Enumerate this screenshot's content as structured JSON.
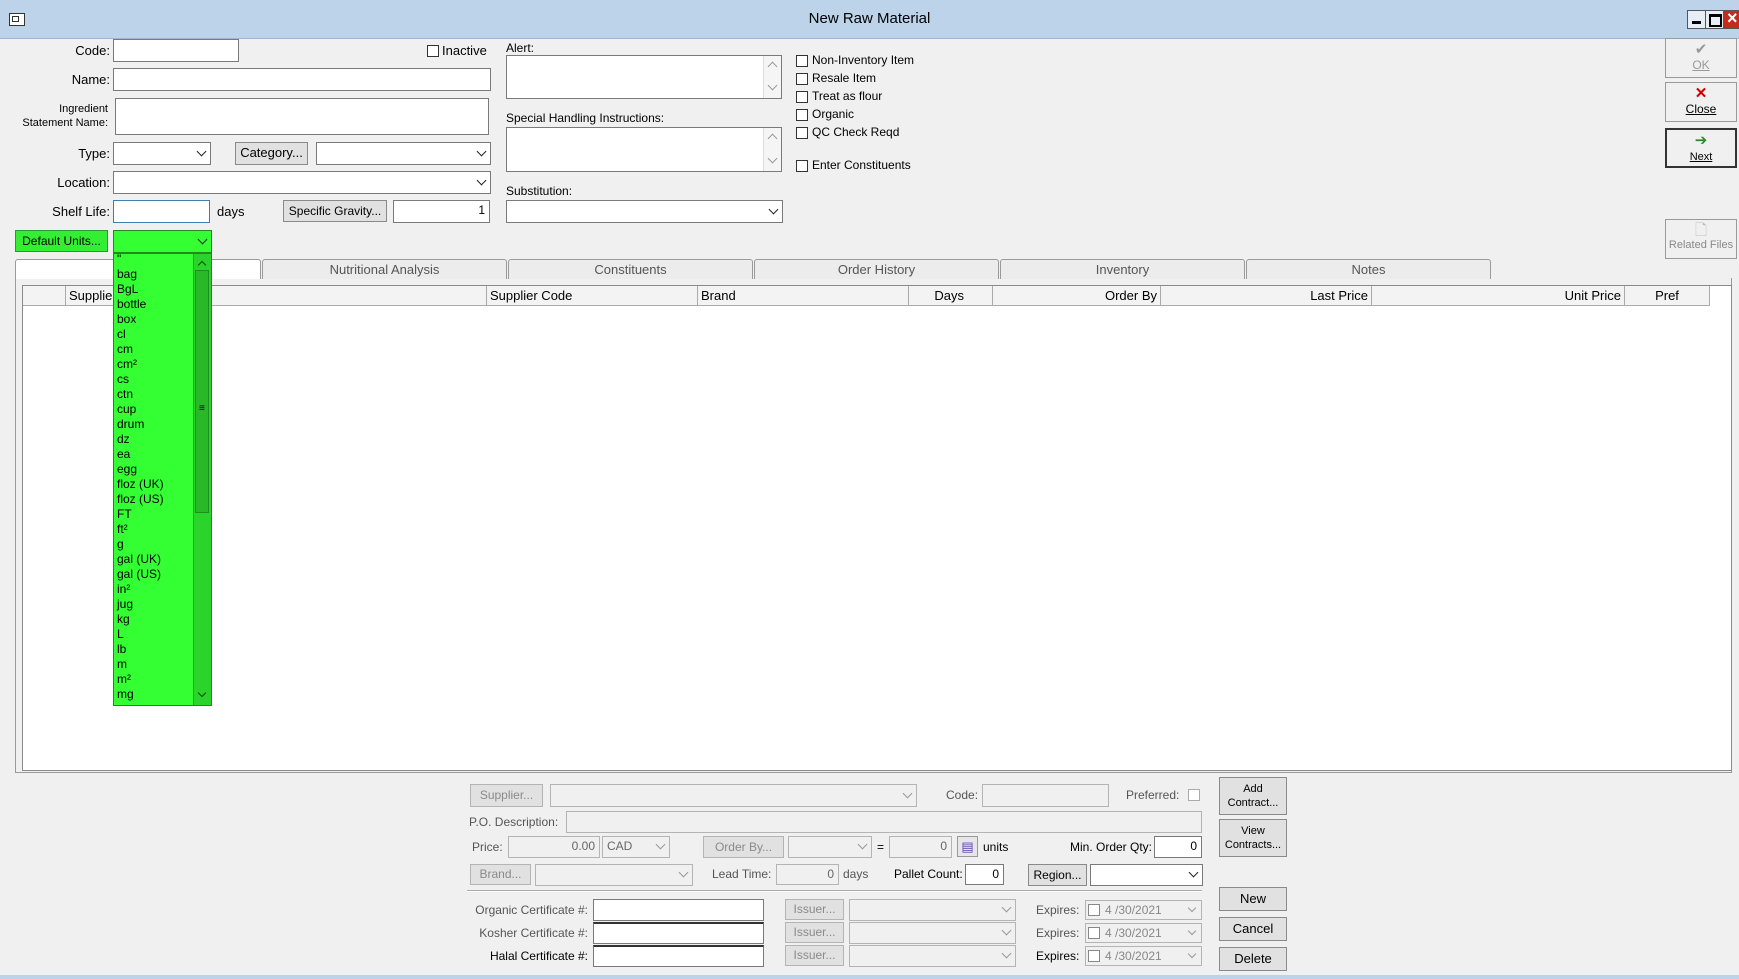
{
  "window": {
    "title": "New Raw Material"
  },
  "form": {
    "code_label": "Code:",
    "inactive_label": "Inactive",
    "name_label": "Name:",
    "ingredient_statement_label_line1": "Ingredient",
    "ingredient_statement_label_line2": "Statement Name:",
    "type_label": "Type:",
    "category_button": "Category...",
    "location_label": "Location:",
    "shelf_life_label": "Shelf Life:",
    "shelf_life_unit": "days",
    "specific_gravity_button": "Specific Gravity...",
    "specific_gravity_value": "1",
    "default_units_button": "Default Units...",
    "alert_label": "Alert:",
    "special_handling_label": "Special Handling Instructions:",
    "substitution_label": "Substitution:"
  },
  "checkboxes": [
    {
      "label": "Non-Inventory Item"
    },
    {
      "label": "Resale Item"
    },
    {
      "label": "Treat as flour"
    },
    {
      "label": "Organic"
    },
    {
      "label": "QC Check Reqd"
    },
    {
      "label": "Enter Constituents"
    }
  ],
  "side_buttons": {
    "ok": {
      "label": "OK",
      "icon": "checkmark-icon"
    },
    "close": {
      "label": "Close",
      "icon": "red-x-icon"
    },
    "next": {
      "label": "Next",
      "icon": "next-arrow-icon"
    },
    "related_files": {
      "label": "Related Files",
      "icon": "document-icon"
    }
  },
  "units_dropdown": {
    "items": [
      "\"",
      "bag",
      "BgL",
      "bottle",
      "box",
      "cl",
      "cm",
      "cm²",
      "cs",
      "ctn",
      "cup",
      "drum",
      "dz",
      "ea",
      "egg",
      "floz (UK)",
      "floz (US)",
      "FT",
      "ft²",
      "g",
      "gal (UK)",
      "gal (US)",
      "in²",
      "jug",
      "kg",
      "L",
      "lb",
      "m",
      "m²",
      "mg"
    ]
  },
  "tabs": [
    {
      "label": "Nutritional Analysis"
    },
    {
      "label": "Constituents"
    },
    {
      "label": "Order History"
    },
    {
      "label": "Inventory"
    },
    {
      "label": "Notes"
    }
  ],
  "grid": {
    "columns": [
      {
        "label": "Supplier"
      },
      {
        "label": "Supplier Code"
      },
      {
        "label": "Brand"
      },
      {
        "label": "Days"
      },
      {
        "label": "Order By"
      },
      {
        "label": "Last Price"
      },
      {
        "label": "Unit Price"
      },
      {
        "label": "Pref"
      }
    ]
  },
  "supplier_detail": {
    "supplier_button": "Supplier...",
    "code_label": "Code:",
    "preferred_label": "Preferred:",
    "add_contract_line1": "Add",
    "add_contract_line2": "Contract...",
    "view_contracts_line1": "View",
    "view_contracts_line2": "Contracts...",
    "po_description_label": "P.O. Description:",
    "price_label": "Price:",
    "price_value": "0.00",
    "currency_value": "CAD",
    "order_by_button": "Order By...",
    "equals": "=",
    "qty_value": "0",
    "units_label": "units",
    "min_order_qty_label": "Min. Order Qty:",
    "min_order_qty_value": "0",
    "brand_button": "Brand...",
    "lead_time_label": "Lead Time:",
    "lead_time_value": "0",
    "lead_time_unit": "days",
    "pallet_count_label": "Pallet Count:",
    "pallet_count_value": "0",
    "region_button": "Region...",
    "organic_cert_label": "Organic Certificate #:",
    "kosher_cert_label": "Kosher Certificate #:",
    "halal_cert_label": "Halal Certificate #:",
    "issuer_button": "Issuer...",
    "expires_label": "Expires:",
    "expires_date": "4 /30/2021",
    "new_button": "New",
    "cancel_button": "Cancel",
    "delete_button": "Delete"
  }
}
